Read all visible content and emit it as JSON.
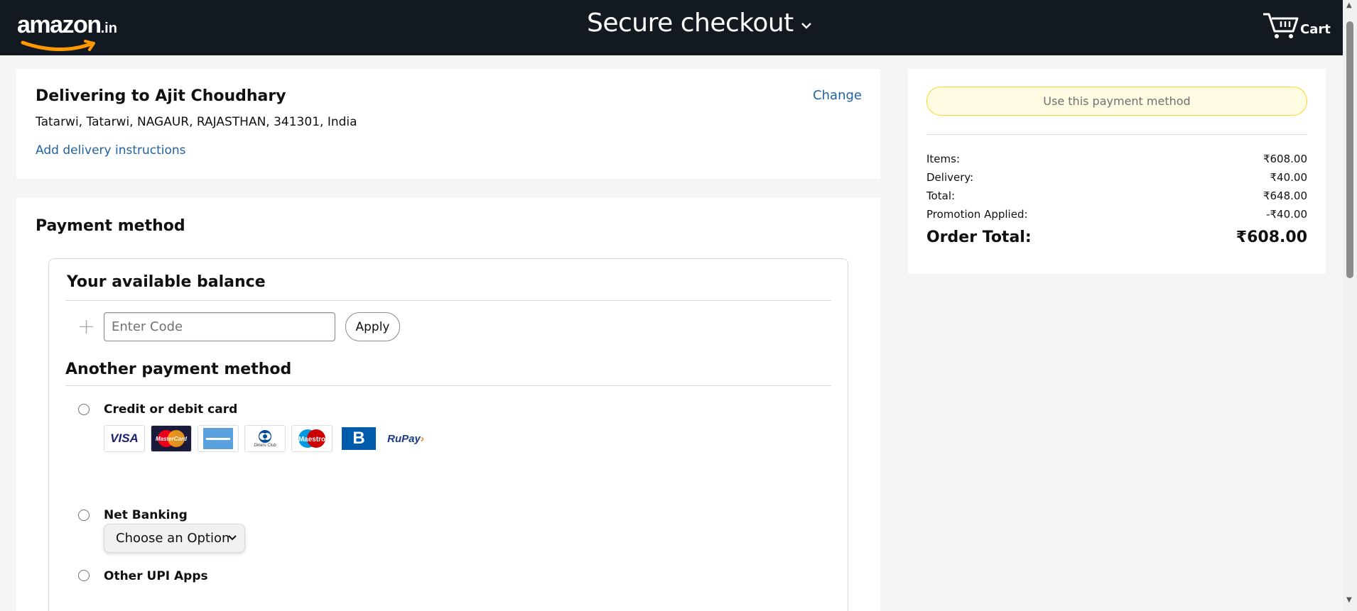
{
  "header": {
    "logo_text": "amazon",
    "logo_tld": ".in",
    "title": "Secure checkout",
    "cart_label": "Cart",
    "bg_color": "#131921",
    "logo_accent": "#ff9900"
  },
  "delivery": {
    "title": "Delivering to Ajit Choudhary",
    "address": "Tatarwi, Tatarwi, NAGAUR, RAJASTHAN, 341301, India",
    "add_instructions": "Add delivery instructions",
    "change_label": "Change"
  },
  "payment": {
    "title": "Payment method",
    "balance_title": "Your available balance",
    "code_placeholder": "Enter Code",
    "apply_label": "Apply",
    "another_title": "Another payment method",
    "options": [
      {
        "label": "Credit or debit card"
      },
      {
        "label": "Net Banking"
      },
      {
        "label": "Other UPI Apps"
      }
    ],
    "card_logos": [
      "VISA",
      "MasterCard",
      "American Express",
      "Diners Club International",
      "Maestro",
      "Bajaj Finserv",
      "RuPay"
    ],
    "netbanking_select": "Choose an Option"
  },
  "summary": {
    "use_button": "Use this payment method",
    "rows": [
      {
        "label": "Items:",
        "value": "₹608.00"
      },
      {
        "label": "Delivery:",
        "value": "₹40.00"
      },
      {
        "label": "Total:",
        "value": "₹648.00"
      },
      {
        "label": "Promotion Applied:",
        "value": "-₹40.00"
      }
    ],
    "order_total_label": "Order Total:",
    "order_total_value": "₹608.00"
  },
  "colors": {
    "link": "#2162a1",
    "button_yellow": "#fffadd",
    "button_border": "#fcd200"
  }
}
